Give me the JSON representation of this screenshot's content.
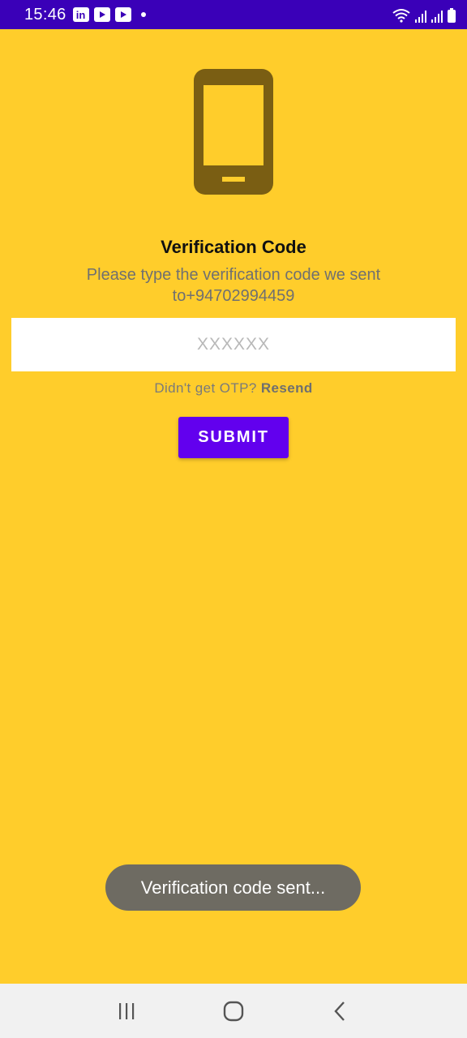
{
  "status_bar": {
    "time": "15:46",
    "apps": [
      "linkedin-icon",
      "youtube-icon",
      "youtube-icon"
    ]
  },
  "content": {
    "title": "Verification Code",
    "subtitle": "Please type the verification code we sent to+94702994459",
    "otp_placeholder": "XXXXXX",
    "otp_value": "",
    "resend_prompt": "Didn't get OTP?",
    "resend_link": "Resend",
    "submit_label": "SUBMIT"
  },
  "toast": {
    "message": "Verification code sent..."
  },
  "colors": {
    "background": "#FFCD2B",
    "status_bar": "#3A00B8",
    "accent": "#6200EE",
    "icon": "#7A5E13"
  },
  "nav": [
    "recent-apps-icon",
    "home-icon",
    "back-icon"
  ]
}
